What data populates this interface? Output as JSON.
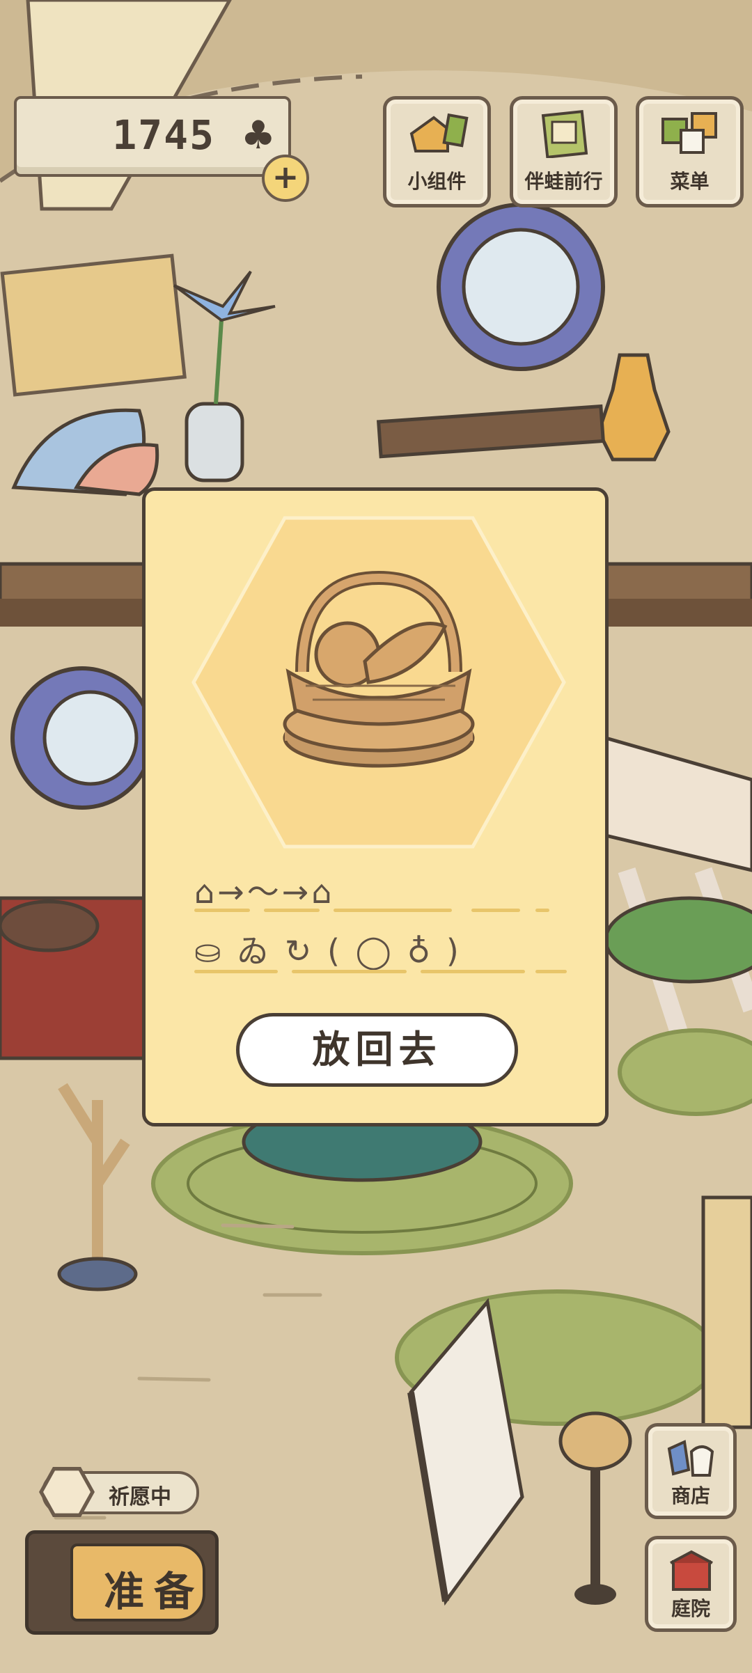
{
  "currency": {
    "value": "1745",
    "icon": "clover-icon",
    "add_icon": "plus-icon"
  },
  "top_menu": [
    {
      "label": "小组件",
      "icon": "widget-icon"
    },
    {
      "label": "伴蛙前行",
      "icon": "album-icon"
    },
    {
      "label": "菜单",
      "icon": "menu-icon"
    }
  ],
  "item_modal": {
    "item_icon": "fruit-basket-icon",
    "line1": "⌂→〜→⌂",
    "line2": "⛀ ゐ ↻ ( ◯ ♁ )",
    "return_label": "放回去"
  },
  "wish": {
    "label": "祈愿中",
    "icon": "basket-badge-icon"
  },
  "prepare": {
    "label": "准备"
  },
  "side_menu": [
    {
      "label": "商店",
      "icon": "shop-icon"
    },
    {
      "label": "庭院",
      "icon": "yard-icon"
    }
  ],
  "colors": {
    "modal_bg": "#fbe6a7",
    "hex_bg": "#f9d990",
    "outline": "#4a3f35",
    "wall": "#d8c7a6"
  }
}
